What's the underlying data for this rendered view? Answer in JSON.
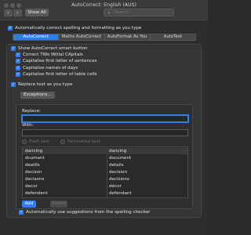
{
  "window": {
    "title": "AutoCorrect: English (AUS)",
    "show_all": "Show All",
    "search_placeholder": "Search"
  },
  "options": {
    "auto_correct_label": "Automatically correct spelling and formatting as you type"
  },
  "tabs": [
    {
      "label": "AutoCorrect",
      "active": true
    },
    {
      "label": "Maths AutoCorrect",
      "active": false
    },
    {
      "label": "AutoFormat As You Type",
      "active": false
    },
    {
      "label": "AutoText",
      "active": false
    }
  ],
  "autocorrect": {
    "show_button_label": "Show AutoCorrect smart button",
    "checks": [
      {
        "label": "Correct TWo INitial CApitals",
        "checked": true
      },
      {
        "label": "Capitalise first letter of sentences",
        "checked": true
      },
      {
        "label": "Capitalise names of days",
        "checked": true
      },
      {
        "label": "Capitalise first letter of table cells",
        "checked": true
      }
    ],
    "replace_label": "Replace text as you type",
    "exceptions_label": "Exceptions…",
    "replace_field_label": "Replace:",
    "with_field_label": "With:",
    "replace_value": "",
    "with_value": "",
    "plain_text_label": "Plain text",
    "formatted_text_label": "Formatted text",
    "table": [
      [
        "dancing",
        "dancing"
      ],
      [
        "dcument",
        "document"
      ],
      [
        "deatils",
        "details"
      ],
      [
        "decison",
        "decision"
      ],
      [
        "decisons",
        "decisions"
      ],
      [
        "decor",
        "décor"
      ],
      [
        "defendent",
        "defendant"
      ]
    ],
    "add_label": "Add",
    "delete_label": "Delete",
    "suggestions_label": "Automatically use suggestions from the spelling checker"
  },
  "colors": {
    "accent": "#2d7ef0",
    "window_bg": "#2e2e2e"
  }
}
